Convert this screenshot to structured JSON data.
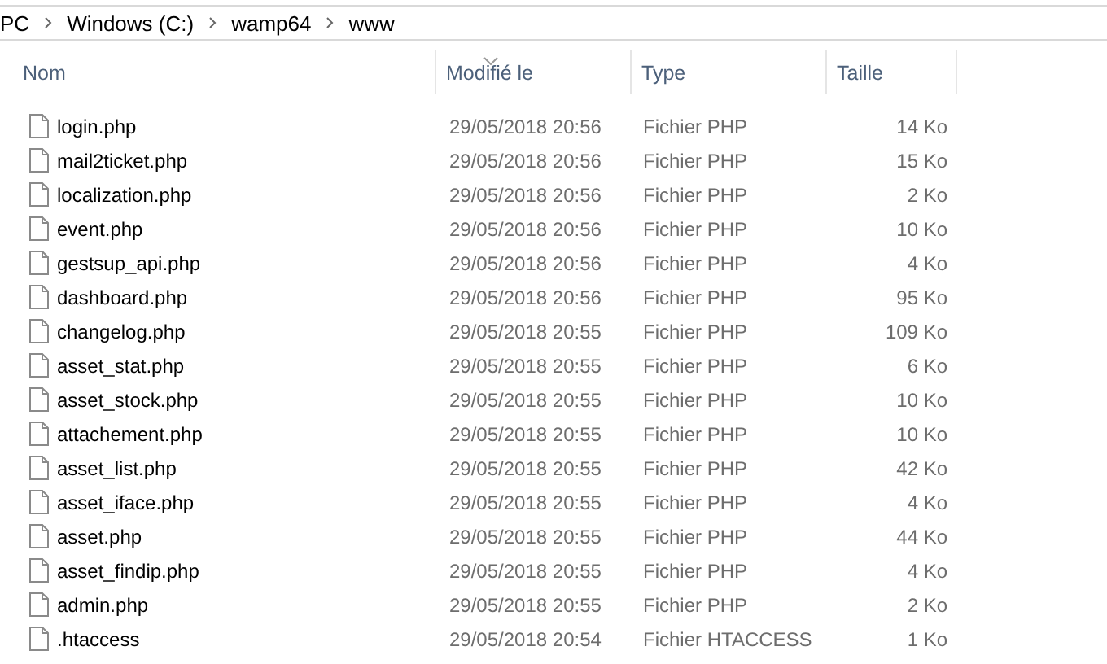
{
  "address_bar": {
    "path": [
      "PC",
      "Windows (C:)",
      "wamp64",
      "www"
    ]
  },
  "table": {
    "columns": [
      {
        "label": "Nom",
        "sorted": false
      },
      {
        "label": "Modifié le",
        "sorted": true
      },
      {
        "label": "Type",
        "sorted": false
      },
      {
        "label": "Taille",
        "sorted": false
      }
    ],
    "rows": [
      {
        "name": "login.php",
        "modified": "29/05/2018 20:56",
        "type": "Fichier PHP",
        "size": "14 Ko"
      },
      {
        "name": "mail2ticket.php",
        "modified": "29/05/2018 20:56",
        "type": "Fichier PHP",
        "size": "15 Ko"
      },
      {
        "name": "localization.php",
        "modified": "29/05/2018 20:56",
        "type": "Fichier PHP",
        "size": "2 Ko"
      },
      {
        "name": "event.php",
        "modified": "29/05/2018 20:56",
        "type": "Fichier PHP",
        "size": "10 Ko"
      },
      {
        "name": "gestsup_api.php",
        "modified": "29/05/2018 20:56",
        "type": "Fichier PHP",
        "size": "4 Ko"
      },
      {
        "name": "dashboard.php",
        "modified": "29/05/2018 20:56",
        "type": "Fichier PHP",
        "size": "95 Ko"
      },
      {
        "name": "changelog.php",
        "modified": "29/05/2018 20:55",
        "type": "Fichier PHP",
        "size": "109 Ko"
      },
      {
        "name": "asset_stat.php",
        "modified": "29/05/2018 20:55",
        "type": "Fichier PHP",
        "size": "6 Ko"
      },
      {
        "name": "asset_stock.php",
        "modified": "29/05/2018 20:55",
        "type": "Fichier PHP",
        "size": "10 Ko"
      },
      {
        "name": "attachement.php",
        "modified": "29/05/2018 20:55",
        "type": "Fichier PHP",
        "size": "10 Ko"
      },
      {
        "name": "asset_list.php",
        "modified": "29/05/2018 20:55",
        "type": "Fichier PHP",
        "size": "42 Ko"
      },
      {
        "name": "asset_iface.php",
        "modified": "29/05/2018 20:55",
        "type": "Fichier PHP",
        "size": "4 Ko"
      },
      {
        "name": "asset.php",
        "modified": "29/05/2018 20:55",
        "type": "Fichier PHP",
        "size": "44 Ko"
      },
      {
        "name": "asset_findip.php",
        "modified": "29/05/2018 20:55",
        "type": "Fichier PHP",
        "size": "4 Ko"
      },
      {
        "name": "admin.php",
        "modified": "29/05/2018 20:55",
        "type": "Fichier PHP",
        "size": "2 Ko"
      },
      {
        "name": ".htaccess",
        "modified": "29/05/2018 20:54",
        "type": "Fichier HTACCESS",
        "size": "1 Ko"
      }
    ]
  }
}
